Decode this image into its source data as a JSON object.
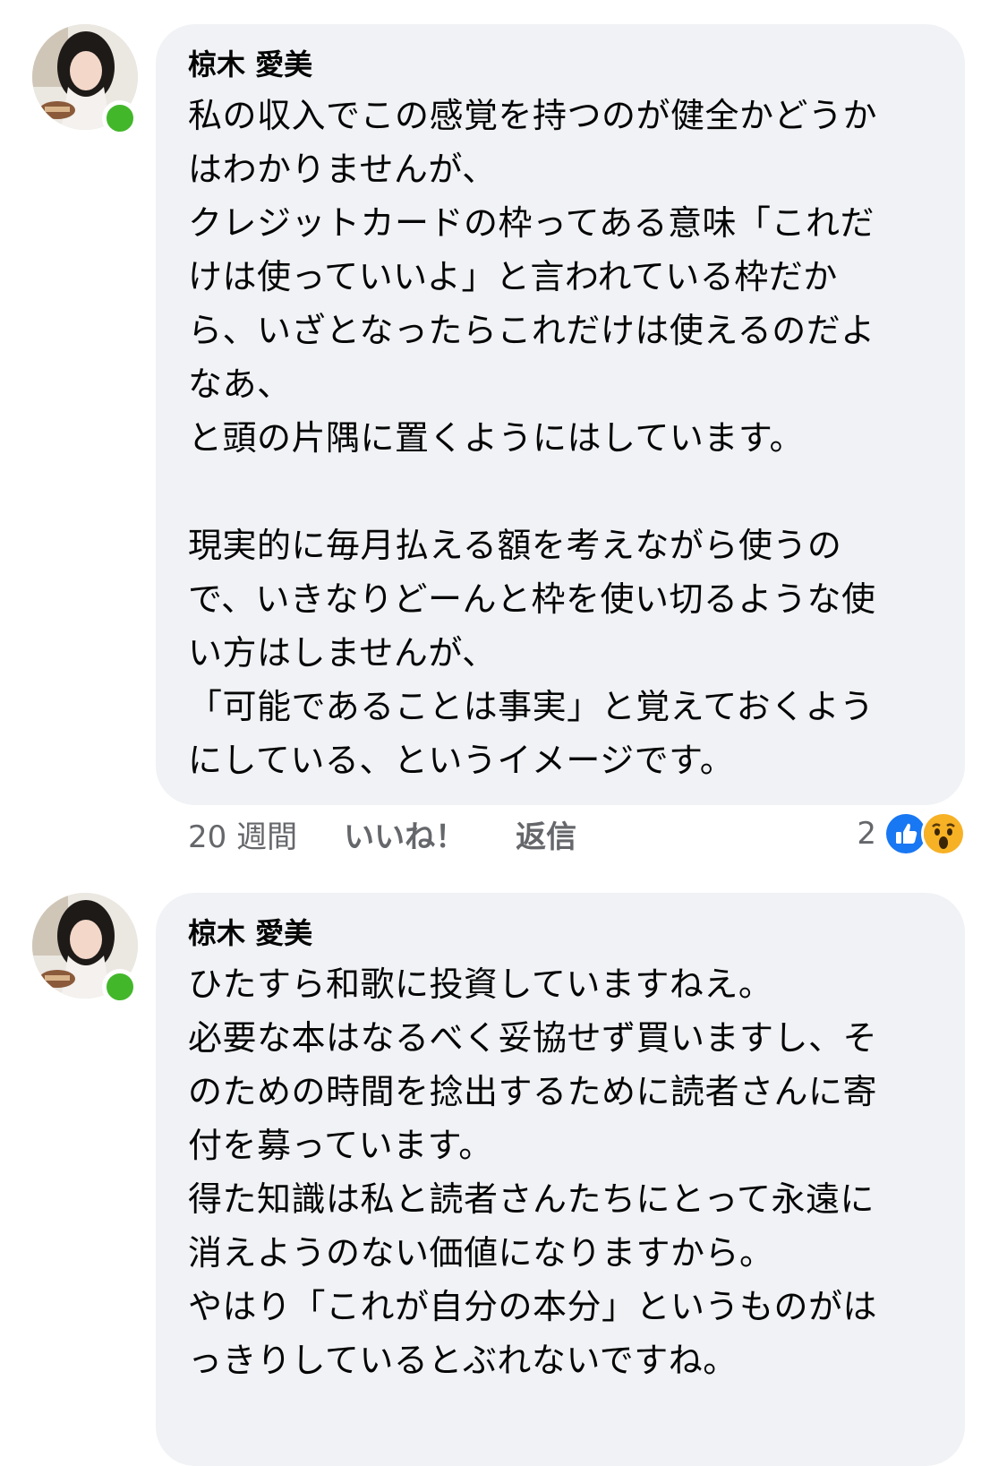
{
  "comments": [
    {
      "author": "椋木 愛美",
      "text": "私の収入でこの感覚を持つのが健全かどうか\nはわかりませんが、\nクレジットカードの枠ってある意味「これだ\nけは使っていいよ」と言われている枠だか\nら、いざとなったらこれだけは使えるのだよ\nなあ、\nと頭の片隅に置くようにはしています。\n\n現実的に毎月払える額を考えながら使うの\nで、いきなりどーんと枠を使い切るような使\nい方はしませんが、\n「可能であることは事実」と覚えておくよう\nにしている、というイメージです。",
      "time": "20 週間",
      "like_label": "いいね！",
      "reply_label": "返信",
      "reaction_count": "2",
      "reactions": [
        "like-icon",
        "wow-icon"
      ],
      "online": true
    },
    {
      "author": "椋木 愛美",
      "text": "ひたすら和歌に投資していますねえ。\n必要な本はなるべく妥協せず買いますし、そ\nのための時間を捻出するために読者さんに寄\n付を募っています。\n得た知識は私と読者さんたちにとって永遠に\n消えようのない価値になりますから。\nやはり「これが自分の本分」というものがは\nっきりしているとぶれないですね。",
      "online": true
    }
  ],
  "colors": {
    "bubble": "#f0f2f5",
    "secondary_text": "#65676b",
    "online": "#42b72a",
    "like_blue": "#1877f2",
    "wow_yellow": "#f7b125"
  }
}
